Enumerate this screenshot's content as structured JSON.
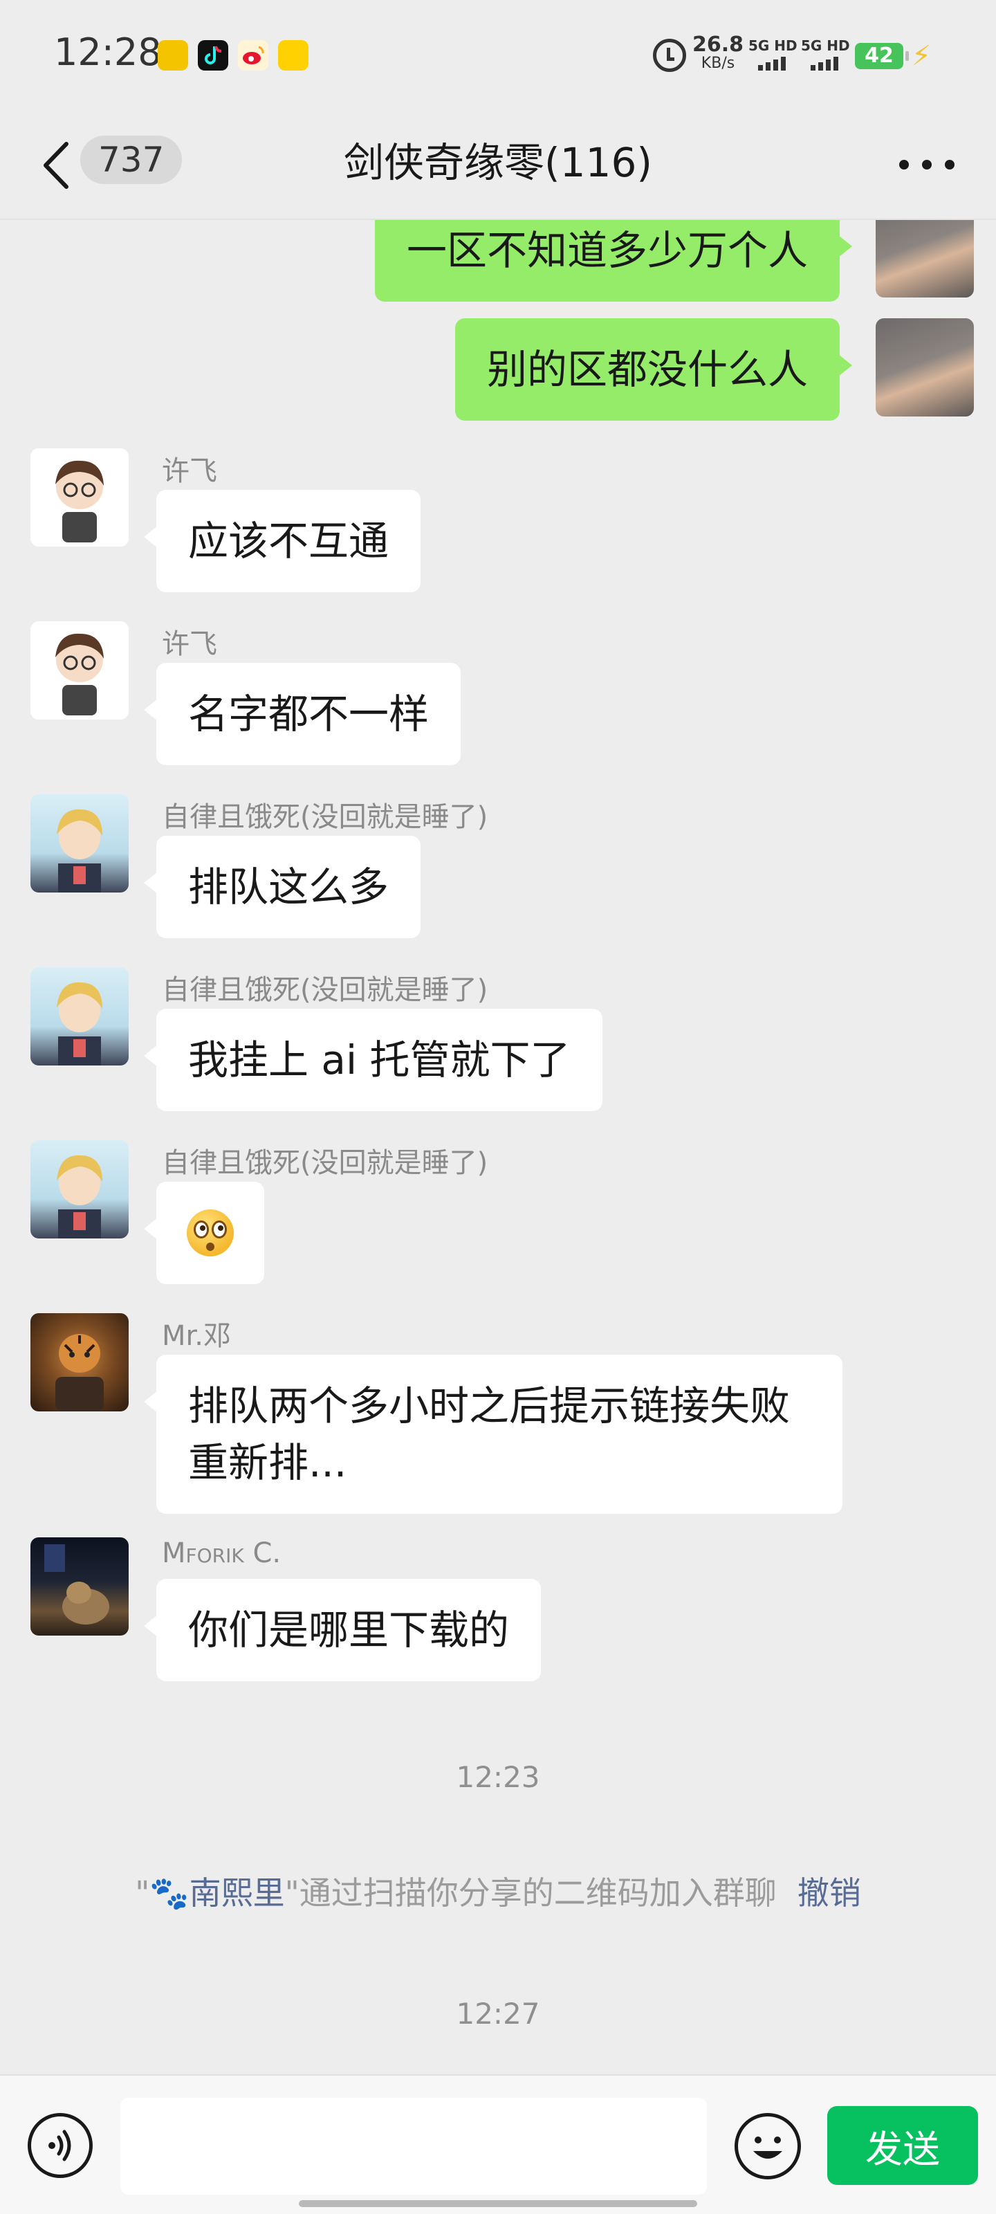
{
  "status_bar": {
    "time": "12:28",
    "app_icons": [
      "news-app-icon",
      "tiktok-icon",
      "weibo-icon",
      "meituan-icon"
    ],
    "net_speed": "26.8",
    "net_speed_unit": "KB/s",
    "sim1_label": "5G HD",
    "sim2_label": "5G HD",
    "battery": "42"
  },
  "header": {
    "unread_count": "737",
    "title": "剑侠奇缘零(116)"
  },
  "messages": [
    {
      "type": "outgoing",
      "text": "一区不知道多少万个人"
    },
    {
      "type": "outgoing",
      "text": "别的区都没什么人"
    },
    {
      "type": "incoming",
      "sender": "许飞",
      "text": "应该不互通"
    },
    {
      "type": "incoming",
      "sender": "许飞",
      "text": "名字都不一样"
    },
    {
      "type": "incoming",
      "sender": "自律且饿死(没回就是睡了)",
      "text": "排队这么多"
    },
    {
      "type": "incoming",
      "sender": "自律且饿死(没回就是睡了)",
      "text": "我挂上 ai 托管就下了"
    },
    {
      "type": "incoming",
      "sender": "自律且饿死(没回就是睡了)",
      "emoji": "flushed-face-emoji"
    },
    {
      "type": "incoming",
      "sender": "Mr.邓",
      "text_line1": "排队两个多小时之后提示链接失败",
      "text_line2": "重新排..."
    },
    {
      "type": "incoming",
      "sender": "Mforik C.",
      "text": "你们是哪里下载的"
    }
  ],
  "time_separators": [
    "12:23",
    "12:27"
  ],
  "system_message": {
    "quote_open": "\"",
    "name": "🐾南熙里",
    "text": "\"通过扫描你分享的二维码加入群聊",
    "undo": "撤销"
  },
  "input_bar": {
    "input_value": "",
    "send_label": "发送"
  },
  "colors": {
    "background": "#ededed",
    "outgoing_bubble": "#95ec69",
    "incoming_bubble": "#ffffff",
    "send_button": "#07c160",
    "link": "#576b95",
    "battery": "#46c35a"
  }
}
